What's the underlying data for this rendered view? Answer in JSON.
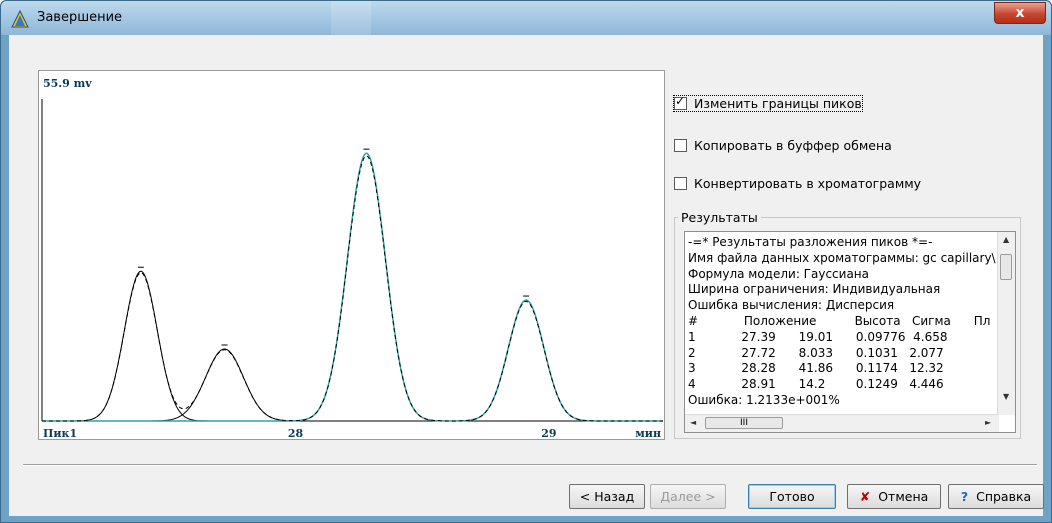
{
  "window": {
    "title": "Завершение",
    "close_label": "x"
  },
  "chart": {
    "y_max_label": "55.9 mv",
    "peak_label": "Пик1",
    "x_tick_1": "28",
    "x_tick_2": "29",
    "x_unit": "мин"
  },
  "chart_data": {
    "type": "line",
    "xlabel": "мин",
    "ylabel": "",
    "ylim": [
      0,
      55.9
    ],
    "x_ticks": [
      "28",
      "29"
    ],
    "series": [
      {
        "kind": "component",
        "center": 27.39,
        "sigma_rel": 0.065,
        "height": 26
      },
      {
        "kind": "component",
        "center": 27.72,
        "sigma_rel": 0.075,
        "height": 12.5
      },
      {
        "kind": "component",
        "center": 28.28,
        "sigma_rel": 0.075,
        "height": 46.5
      },
      {
        "kind": "component",
        "center": 28.91,
        "sigma_rel": 0.07,
        "height": 21
      }
    ],
    "colors": {
      "components": "#000000",
      "sum": "#000000",
      "data": "#2aa5a5"
    }
  },
  "options": {
    "change_bounds": {
      "label": "Изменить границы пиков",
      "checked": true
    },
    "copy_clipboard": {
      "label": "Копировать в буффер обмена",
      "checked": false
    },
    "convert": {
      "label": "Конвертировать в хроматограмму",
      "checked": false
    }
  },
  "results": {
    "group_label": "Результаты",
    "lines": [
      "-=* Результаты разложения пиков *=-",
      "Имя файла данных хроматограммы: gc capillary\\~S",
      "Формула модели: Гауссиана",
      "Ширина ограничения: Индивидуальная",
      "Ошибка вычисления: Дисперсия",
      "#            Положение          Высота   Сигма      Пл",
      "1            27.39      19.01      0.09776  4.658",
      "2            27.72      8.033      0.1031   2.077",
      "3            28.28      41.86      0.1174   12.32",
      "4            28.91      14.2        0.1249   4.446",
      "Ошибка: 1.2133e+001%"
    ],
    "hscroll_thumb": "III"
  },
  "buttons": {
    "back": "< Назад",
    "next": "Далее >",
    "finish": "Готово",
    "cancel": "Отмена",
    "help": "Справка"
  }
}
